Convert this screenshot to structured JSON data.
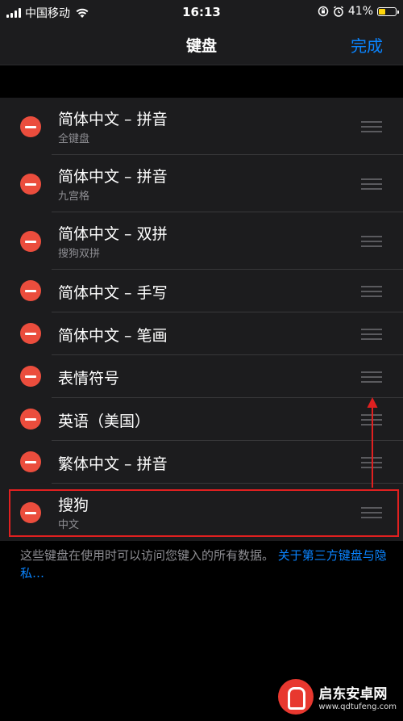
{
  "status": {
    "carrier": "中国移动",
    "time": "16:13",
    "battery": "41%",
    "battery_level": 0.41,
    "battery_color": "#ffd60a"
  },
  "nav": {
    "title": "键盘",
    "done": "完成"
  },
  "keyboards": [
    {
      "title": "简体中文 – 拼音",
      "subtitle": "全键盘"
    },
    {
      "title": "简体中文 – 拼音",
      "subtitle": "九宫格"
    },
    {
      "title": "简体中文 – 双拼",
      "subtitle": "搜狗双拼"
    },
    {
      "title": "简体中文 – 手写",
      "subtitle": ""
    },
    {
      "title": "简体中文 – 笔画",
      "subtitle": ""
    },
    {
      "title": "表情符号",
      "subtitle": ""
    },
    {
      "title": "英语（美国）",
      "subtitle": ""
    },
    {
      "title": "繁体中文 – 拼音",
      "subtitle": ""
    },
    {
      "title": "搜狗",
      "subtitle": "中文"
    }
  ],
  "footer": {
    "note": "这些键盘在使用时可以访问您键入的所有数据。",
    "link": "关于第三方键盘与隐私…"
  },
  "colors": {
    "accent": "#0a84ff",
    "delete": "#eb4d3d",
    "highlight": "#e02020"
  },
  "icons": {
    "signal": "cellular-signal-icon",
    "wifi": "wifi-icon",
    "lock": "orientation-lock-icon",
    "alarm": "alarm-icon",
    "battery": "battery-icon",
    "delete": "delete-minus-icon",
    "reorder": "reorder-grip-icon"
  },
  "watermark": {
    "name": "启东安卓网",
    "url": "www.qdtufeng.com"
  }
}
